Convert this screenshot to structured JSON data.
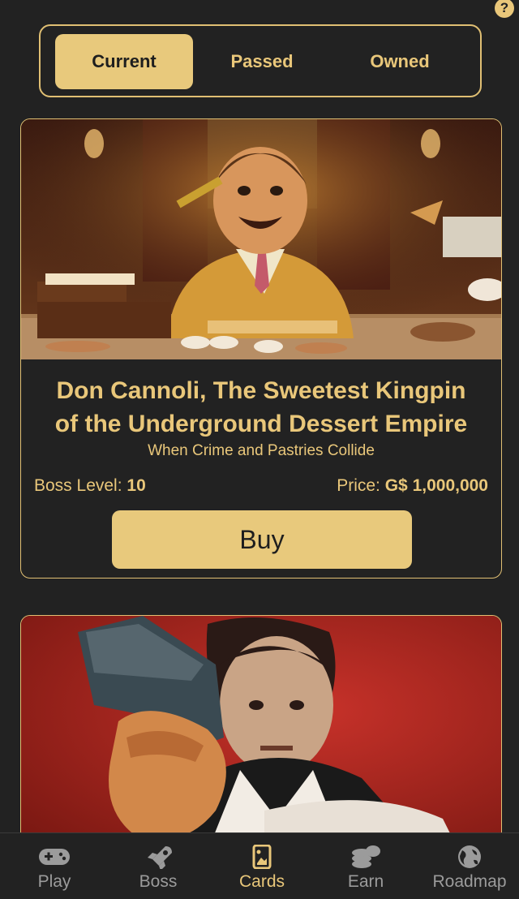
{
  "help": {
    "label": "?"
  },
  "tabs": [
    {
      "label": "Current",
      "active": true
    },
    {
      "label": "Passed",
      "active": false
    },
    {
      "label": "Owned",
      "active": false
    }
  ],
  "card1": {
    "title_line1": "Don Cannoli, The Sweetest Kingpin",
    "title_line2": "of the Underground Dessert Empire",
    "subtitle": "When Crime and Pastries Collide",
    "boss_level_label": "Boss Level:",
    "boss_level": "10",
    "price_label": "Price:",
    "price": "G$ 1,000,000",
    "buy_label": "Buy"
  },
  "nav": [
    {
      "label": "Play",
      "icon": "gamepad-icon"
    },
    {
      "label": "Boss",
      "icon": "rocket-icon"
    },
    {
      "label": "Cards",
      "icon": "cards-icon",
      "active": true
    },
    {
      "label": "Earn",
      "icon": "coins-icon"
    },
    {
      "label": "Roadmap",
      "icon": "globe-icon"
    }
  ],
  "colors": {
    "background": "#222222",
    "accent": "#e8c97c",
    "inactive_nav": "#9b9b9b"
  }
}
